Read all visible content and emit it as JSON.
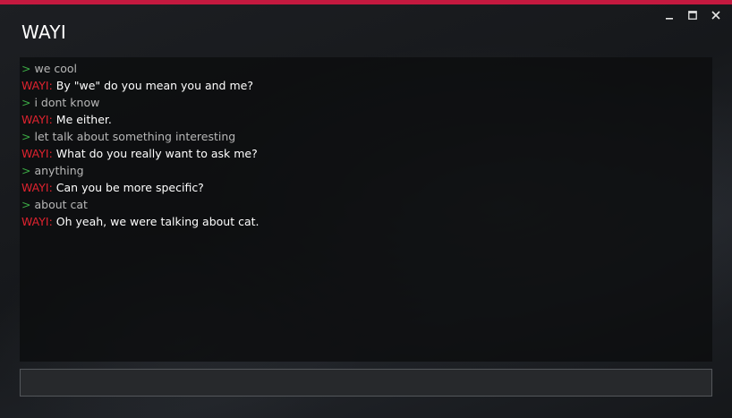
{
  "window": {
    "title": "WAYI",
    "accent_color": "#c4193f",
    "controls": [
      {
        "name": "minimize",
        "icon": "minimize-icon"
      },
      {
        "name": "maximize",
        "icon": "maximize-icon"
      },
      {
        "name": "close",
        "icon": "close-icon"
      }
    ]
  },
  "chat": {
    "user_prompt_symbol": ">",
    "bot_name": "WAYI:",
    "colors": {
      "prompt": "#3cab45",
      "user_text": "#b7b7b7",
      "bot_name": "#e0232f",
      "bot_text": "#ffffff"
    },
    "messages": [
      {
        "speaker": "user",
        "text": "we cool"
      },
      {
        "speaker": "bot",
        "text": "By \"we\" do you mean you and me?"
      },
      {
        "speaker": "user",
        "text": "i dont know"
      },
      {
        "speaker": "bot",
        "text": "Me either."
      },
      {
        "speaker": "user",
        "text": "let talk about something interesting"
      },
      {
        "speaker": "bot",
        "text": "What do you really want to ask me?"
      },
      {
        "speaker": "user",
        "text": "anything"
      },
      {
        "speaker": "bot",
        "text": "Can you be more specific?"
      },
      {
        "speaker": "user",
        "text": "about cat"
      },
      {
        "speaker": "bot",
        "text": "Oh yeah, we were talking about cat."
      }
    ]
  },
  "input": {
    "value": "",
    "placeholder": ""
  }
}
